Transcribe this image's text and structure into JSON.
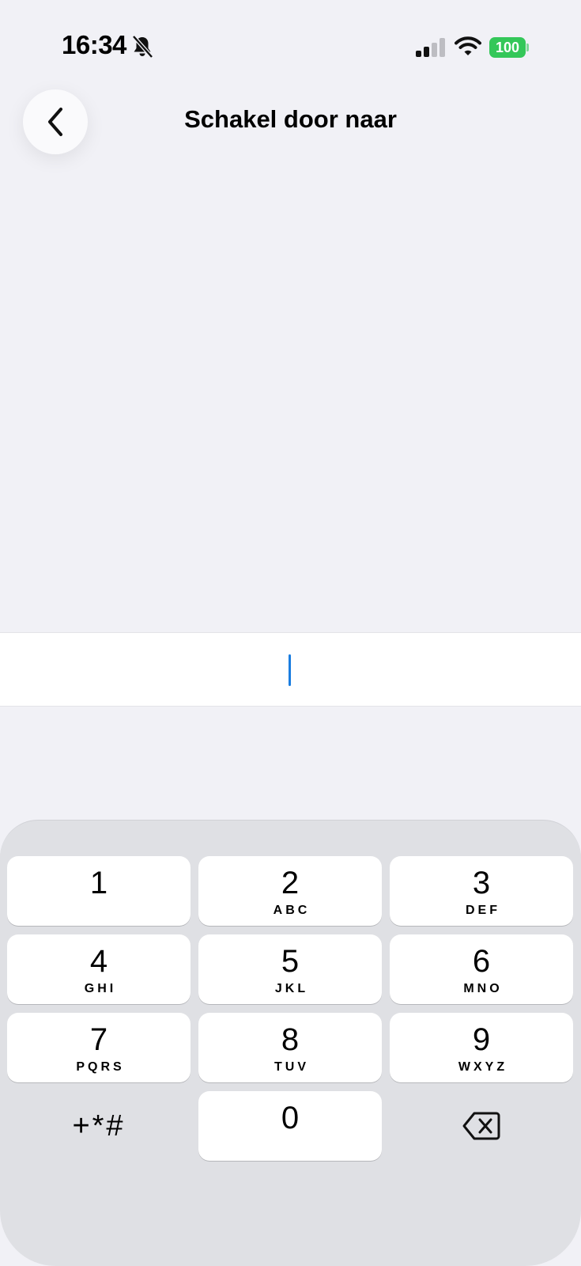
{
  "status_bar": {
    "time": "16:34",
    "battery": "100",
    "icons": [
      "bell-slash-icon",
      "cellular-signal-icon",
      "wifi-icon",
      "battery-icon"
    ],
    "battery_color": "#34c759"
  },
  "header": {
    "title": "Schakel door naar",
    "back_icon": "chevron-left-icon"
  },
  "input": {
    "value": "",
    "cursor_color": "#1a7de0"
  },
  "keypad": {
    "keys": [
      {
        "digit": "1",
        "letters": ""
      },
      {
        "digit": "2",
        "letters": "ABC"
      },
      {
        "digit": "3",
        "letters": "DEF"
      },
      {
        "digit": "4",
        "letters": "GHI"
      },
      {
        "digit": "5",
        "letters": "JKL"
      },
      {
        "digit": "6",
        "letters": "MNO"
      },
      {
        "digit": "7",
        "letters": "PQRS"
      },
      {
        "digit": "8",
        "letters": "TUV"
      },
      {
        "digit": "9",
        "letters": "WXYZ"
      },
      {
        "digit": "0",
        "letters": ""
      }
    ],
    "symbols_label": "+*#",
    "delete_icon": "delete-backspace-icon"
  }
}
